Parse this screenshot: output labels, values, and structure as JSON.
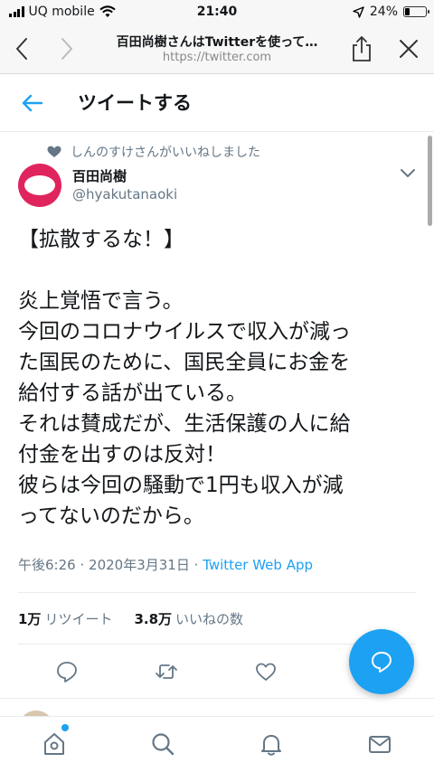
{
  "status_bar": {
    "carrier": "UQ mobile",
    "time": "21:40",
    "battery": "24%",
    "battery_level": 0.24
  },
  "browser": {
    "page_title": "百田尚樹さんはTwitterを使って…",
    "url": "https://twitter.com"
  },
  "header": {
    "title": "ツイートする"
  },
  "tweet": {
    "social_context": "しんのすけさんがいいねしました",
    "author_name": "百田尚樹",
    "author_handle": "@hyakutanaoki",
    "body_lines": [
      "【拡散するな！】",
      "",
      "炎上覚悟で言う。",
      "今回のコロナウイルスで収入が減っ",
      "た国民のために、国民全員にお金を",
      "給付する話が出ている。",
      "それは賛成だが、生活保護の人に給",
      "付金を出すのは反対！",
      "彼らは今回の騒動で1円も収入が減",
      "ってないのだから。"
    ],
    "time": "午後6:26",
    "separator": "·",
    "date": "2020年3月31日",
    "source": "Twitter Web App",
    "retweet_count": "1万",
    "retweet_label": "リツイート",
    "like_count": "3.8万",
    "like_label": "いいねの数"
  },
  "colors": {
    "brand": "#1da1f2",
    "avatar": "#e0245e",
    "secondary_text": "#657786"
  }
}
